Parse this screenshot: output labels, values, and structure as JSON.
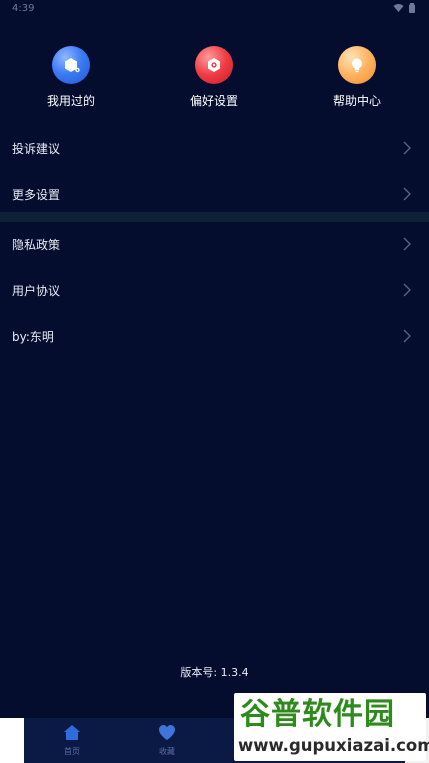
{
  "status_bar": {
    "time": "4:39"
  },
  "quick_actions": [
    {
      "label": "我用过的",
      "icon": "hexagon-icon"
    },
    {
      "label": "偏好设置",
      "icon": "settings-gear-icon"
    },
    {
      "label": "帮助中心",
      "icon": "lightbulb-icon"
    }
  ],
  "menu": {
    "group1": [
      {
        "label": "投诉建议"
      },
      {
        "label": "更多设置"
      }
    ],
    "group2": [
      {
        "label": "隐私政策"
      },
      {
        "label": "用户协议"
      },
      {
        "label": "by:东明"
      }
    ]
  },
  "version": "版本号:  1.3.4",
  "tabs": [
    {
      "label": "首页",
      "icon": "home-icon"
    },
    {
      "label": "收藏",
      "icon": "heart-icon"
    }
  ],
  "watermark": {
    "title": "谷普软件园",
    "url": "www.gupuxiazai.com"
  }
}
